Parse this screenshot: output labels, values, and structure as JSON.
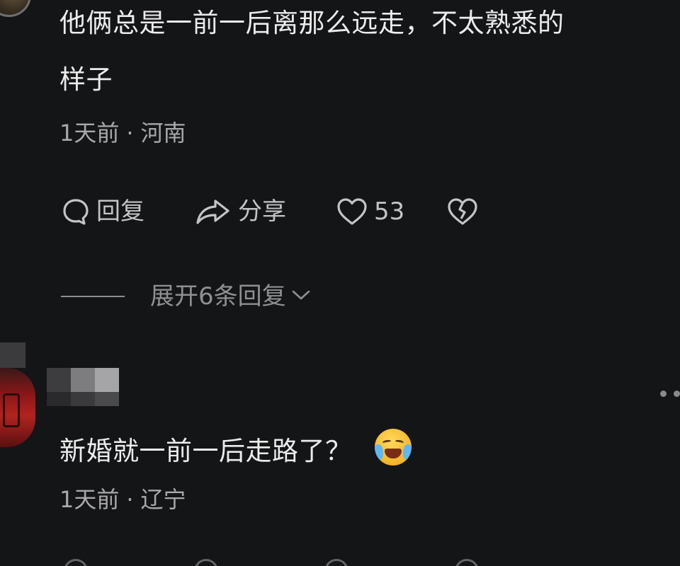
{
  "comment1": {
    "text_line1": "他俩总是一前一后离那么远走，不太熟悉的",
    "text_line2": "样子",
    "time": "1天前",
    "separator": "·",
    "location": "河南",
    "actions": {
      "reply_label": "回复",
      "share_label": "分享",
      "like_count": "53"
    },
    "expand_label": "展开6条回复"
  },
  "comment2": {
    "text": "新婚就一前一后走路了？",
    "emoji": "crying-laughing-emoji",
    "time": "1天前",
    "separator": "·",
    "location": "辽宁"
  },
  "icons": {
    "reply": "comment-bubble-icon",
    "share": "share-arrow-icon",
    "like": "heart-icon",
    "dislike": "broken-heart-icon",
    "expand": "chevron-down-icon",
    "more": "more-dots-icon"
  },
  "colors": {
    "background": "#141517",
    "text_primary": "#ececec",
    "text_secondary": "#a9a9ab"
  }
}
